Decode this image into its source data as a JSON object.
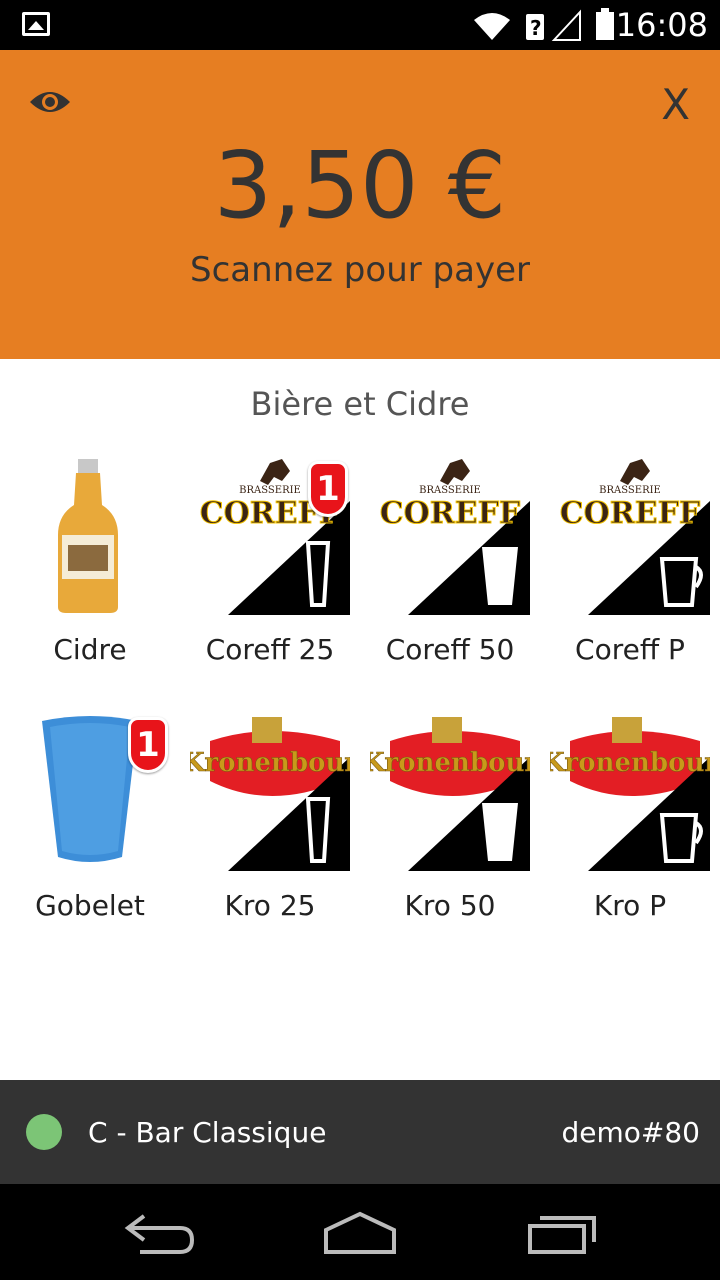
{
  "status_bar": {
    "time": "16:08",
    "icons": [
      "image-notification-icon",
      "wifi-icon",
      "signal-unknown-icon",
      "battery-icon"
    ]
  },
  "header": {
    "amount": "3,50 €",
    "instruction": "Scannez pour payer",
    "close_label": "X",
    "background_color": "#e67e22"
  },
  "category": {
    "title": "Bière et Cidre"
  },
  "products": [
    {
      "label": "Cidre",
      "icon": "cider-bottle-image",
      "badge": ""
    },
    {
      "label": "Coreff 25",
      "icon": "coreff-small-glass-image",
      "badge": "1",
      "brand": "COREFF",
      "brand_top": "BRASSERIE"
    },
    {
      "label": "Coreff 50",
      "icon": "coreff-pint-glass-image",
      "badge": "",
      "brand": "COREFF",
      "brand_top": "BRASSERIE"
    },
    {
      "label": "Coreff P",
      "icon": "coreff-pitcher-image",
      "badge": "",
      "brand": "COREFF",
      "brand_top": "BRASSERIE"
    },
    {
      "label": "Gobelet",
      "icon": "blue-cup-image",
      "badge": "1"
    },
    {
      "label": "Kro 25",
      "icon": "kronenbourg-small-glass-image",
      "badge": "",
      "brand": "Kronenbour"
    },
    {
      "label": "Kro 50",
      "icon": "kronenbourg-pint-glass-image",
      "badge": "",
      "brand": "Kronenbour"
    },
    {
      "label": "Kro P",
      "icon": "kronenbourg-pitcher-image",
      "badge": "",
      "brand": "Kronenbour"
    }
  ],
  "footer": {
    "status_color": "#7cc576",
    "bar_name": "C - Bar Classique",
    "device_id": "demo#80"
  },
  "nav": {
    "buttons": [
      "back-icon",
      "home-icon",
      "recent-apps-icon"
    ]
  }
}
